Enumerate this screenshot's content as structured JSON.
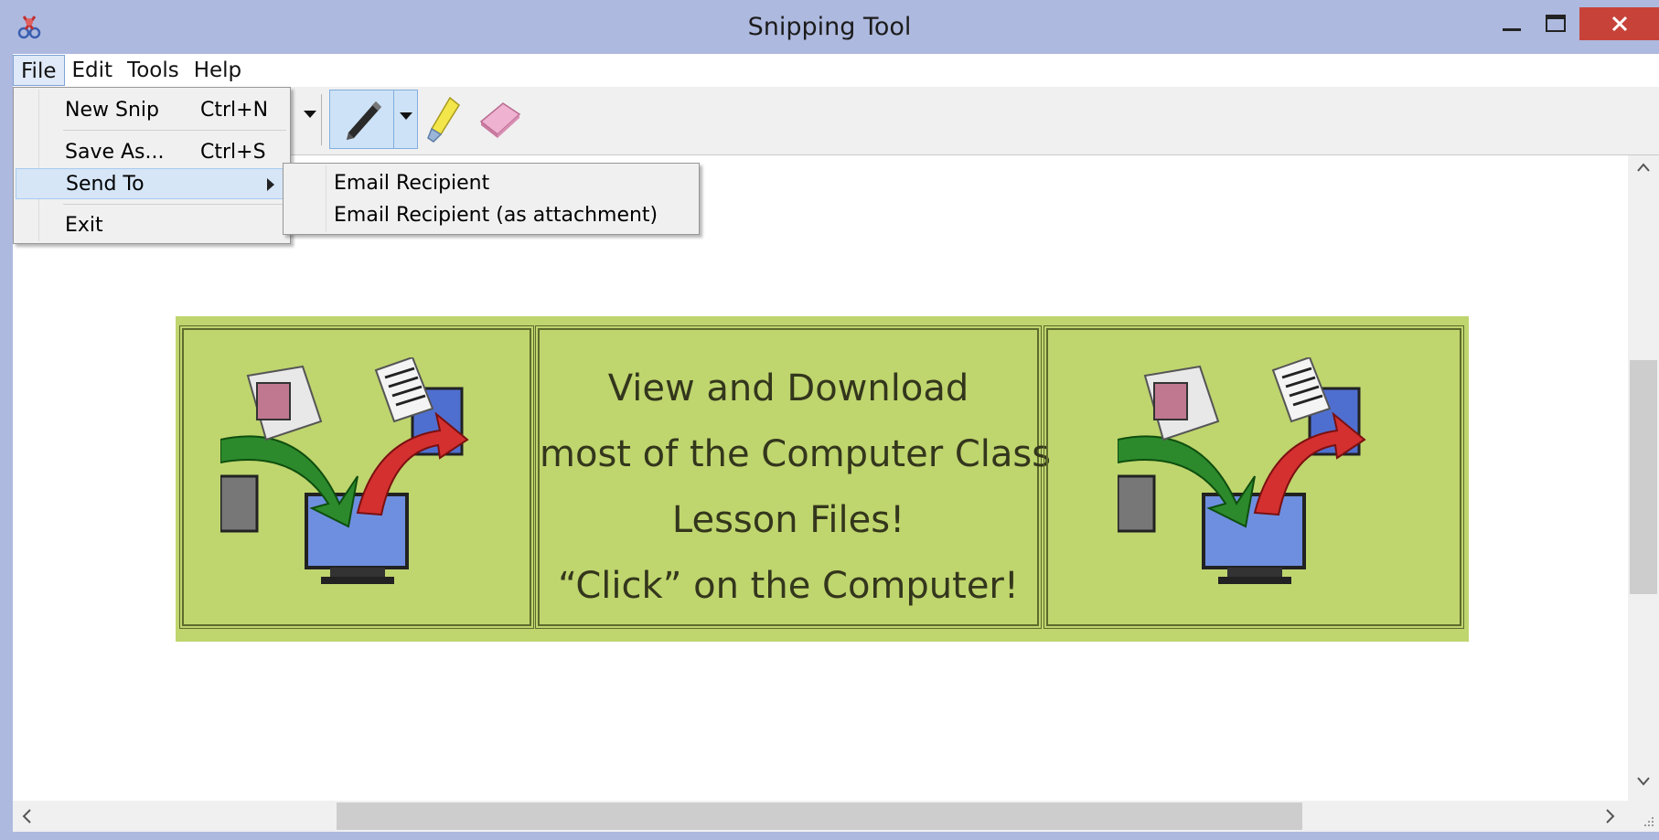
{
  "window": {
    "title": "Snipping Tool",
    "close_color": "#c7433a"
  },
  "menubar": {
    "items": [
      {
        "label": "File"
      },
      {
        "label": "Edit"
      },
      {
        "label": "Tools"
      },
      {
        "label": "Help"
      }
    ]
  },
  "file_menu": {
    "items": [
      {
        "label": "New Snip",
        "shortcut": "Ctrl+N"
      },
      {
        "label": "Save As...",
        "shortcut": "Ctrl+S"
      },
      {
        "label": "Send To"
      },
      {
        "label": "Exit"
      }
    ]
  },
  "send_to_menu": {
    "items": [
      {
        "label": "Email Recipient"
      },
      {
        "label": "Email Recipient (as attachment)"
      }
    ]
  },
  "toolbar": {
    "icons": [
      "pen-icon",
      "highlighter-icon",
      "eraser-icon"
    ]
  },
  "snip": {
    "banner_color": "#bfd56e",
    "lines": [
      "View and Download",
      "most of the Computer Class",
      "Lesson Files!",
      "“Click” on the Computer!"
    ]
  }
}
